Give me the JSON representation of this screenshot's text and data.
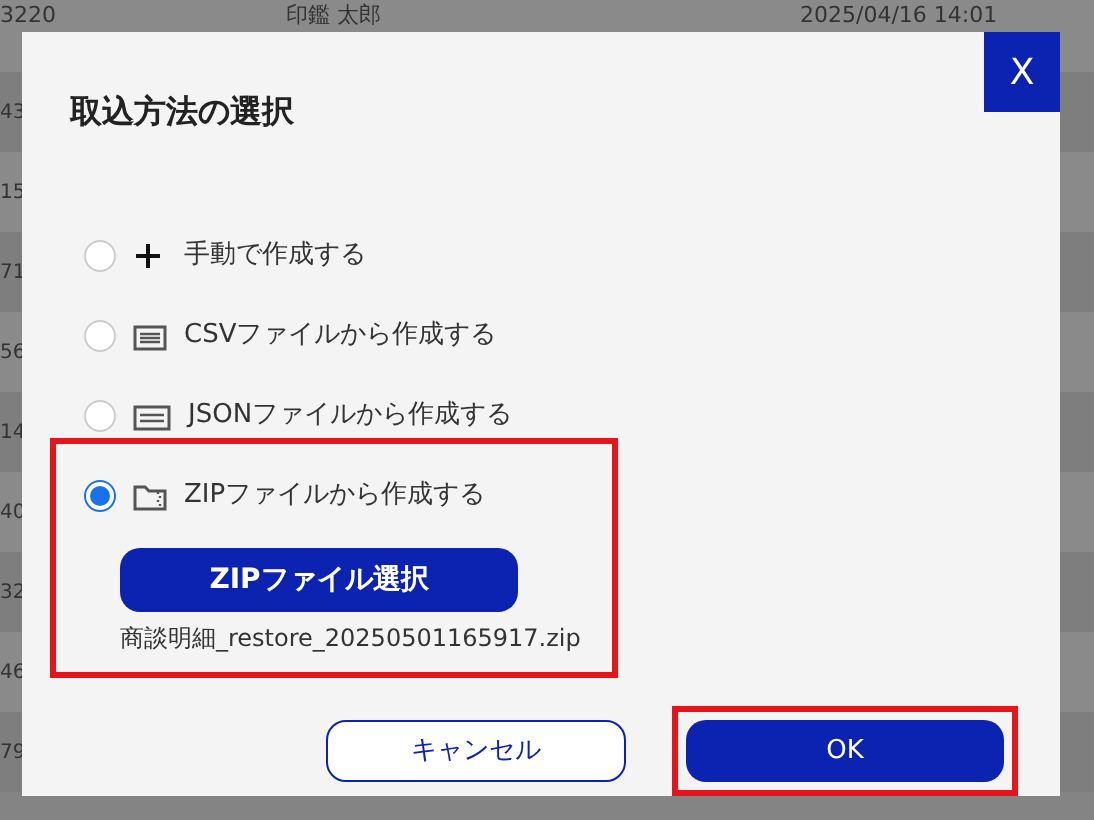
{
  "background_table": {
    "rows": [
      {
        "cells": [
          "3220",
          "印鑑 太郎",
          "2025/04/16 14:01"
        ]
      },
      {
        "cells": [
          "43"
        ]
      },
      {
        "cells": [
          "15"
        ]
      },
      {
        "cells": [
          "71"
        ]
      },
      {
        "cells": [
          "56"
        ]
      },
      {
        "cells": [
          "14"
        ]
      },
      {
        "cells": [
          "40"
        ]
      },
      {
        "cells": [
          "32"
        ]
      },
      {
        "cells": [
          "46"
        ]
      },
      {
        "cells": [
          "79"
        ]
      }
    ]
  },
  "dialog": {
    "title": "取込方法の選択",
    "close_label": "X",
    "options": [
      {
        "kind": "plus",
        "label": "手動で作成する",
        "selected": false,
        "highlighted": false
      },
      {
        "kind": "csv",
        "label": "CSVファイルから作成する",
        "selected": false,
        "highlighted": false
      },
      {
        "kind": "json",
        "label": "JSONファイルから作成する",
        "selected": false,
        "highlighted": false
      },
      {
        "kind": "zip",
        "label": "ZIPファイルから作成する",
        "selected": true,
        "highlighted": true,
        "file_button": "ZIPファイル選択",
        "file_name": "商談明細_restore_20250501165917.zip"
      }
    ],
    "buttons": [
      {
        "kind": "secondary",
        "label": "キャンセル",
        "highlighted": false
      },
      {
        "kind": "primary",
        "label": "OK",
        "highlighted": true
      }
    ]
  }
}
